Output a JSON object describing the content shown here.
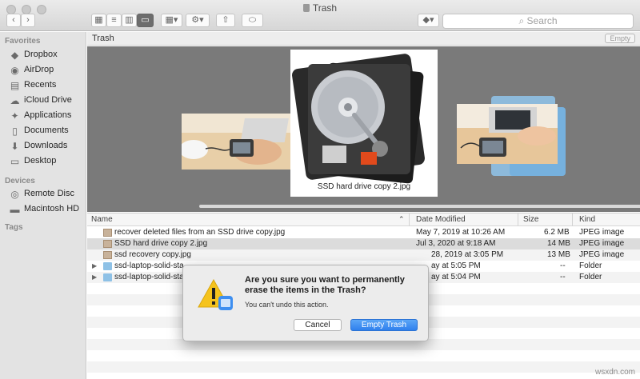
{
  "window": {
    "title": "Trash"
  },
  "toolbar": {
    "back_icon": "chevron-left-icon",
    "forward_icon": "chevron-right-icon",
    "search_placeholder": "Search"
  },
  "sidebar": {
    "favorites_heading": "Favorites",
    "favorites": [
      {
        "label": "Dropbox",
        "icon": "dropbox-icon"
      },
      {
        "label": "AirDrop",
        "icon": "airdrop-icon"
      },
      {
        "label": "Recents",
        "icon": "recents-icon"
      },
      {
        "label": "iCloud Drive",
        "icon": "cloud-icon"
      },
      {
        "label": "Applications",
        "icon": "applications-icon"
      },
      {
        "label": "Documents",
        "icon": "documents-icon"
      },
      {
        "label": "Downloads",
        "icon": "downloads-icon"
      },
      {
        "label": "Desktop",
        "icon": "desktop-icon"
      }
    ],
    "devices_heading": "Devices",
    "devices": [
      {
        "label": "Remote Disc",
        "icon": "disc-icon"
      },
      {
        "label": "Macintosh HD",
        "icon": "harddisk-icon"
      }
    ],
    "tags_heading": "Tags"
  },
  "pathbar": {
    "label": "Trash",
    "empty_button": "Empty"
  },
  "coverflow": {
    "caption": "SSD hard drive copy 2.jpg"
  },
  "list": {
    "headers": {
      "name": "Name",
      "date": "Date Modified",
      "size": "Size",
      "kind": "Kind"
    },
    "rows": [
      {
        "name": "recover deleted files from an SSD drive copy.jpg",
        "date": "May 7, 2019 at 10:26 AM",
        "size": "6.2 MB",
        "kind": "JPEG image"
      },
      {
        "name": "SSD hard drive copy 2.jpg",
        "date": "Jul 3, 2020 at 9:18 AM",
        "size": "14 MB",
        "kind": "JPEG image"
      },
      {
        "name": "ssd recovery copy.jpg",
        "date": "28, 2019 at 3:05 PM",
        "size": "13 MB",
        "kind": "JPEG image"
      },
      {
        "name": "ssd-laptop-solid-sta",
        "date": "ay at 5:05 PM",
        "size": "--",
        "kind": "Folder"
      },
      {
        "name": "ssd-laptop-solid-sta",
        "date": "ay at 5:04 PM",
        "size": "--",
        "kind": "Folder"
      }
    ]
  },
  "dialog": {
    "title": "Are you sure you want to permanently erase the items in the Trash?",
    "message": "You can't undo this action.",
    "cancel_label": "Cancel",
    "confirm_label": "Empty Trash",
    "icon": "warning-icon"
  },
  "watermark": "wsxdn.com",
  "colors": {
    "accent": "#2f80ed",
    "folder": "#8ec1e6"
  }
}
